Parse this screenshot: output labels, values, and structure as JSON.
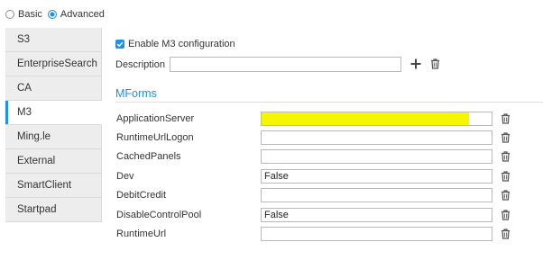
{
  "mode": {
    "basic_label": "Basic",
    "advanced_label": "Advanced",
    "selected": "Advanced"
  },
  "sidebar": {
    "items": [
      {
        "label": "S3"
      },
      {
        "label": "EnterpriseSearch"
      },
      {
        "label": "CA"
      },
      {
        "label": "M3"
      },
      {
        "label": "Ming.le"
      },
      {
        "label": "External"
      },
      {
        "label": "SmartClient"
      },
      {
        "label": "Startpad"
      }
    ],
    "active": "M3"
  },
  "config": {
    "enable_label": "Enable M3 configuration",
    "enabled": true,
    "description_label": "Description",
    "description_value": ""
  },
  "mforms": {
    "title": "MForms",
    "fields": [
      {
        "label": "ApplicationServer",
        "value": ""
      },
      {
        "label": "RuntimeUrlLogon",
        "value": ""
      },
      {
        "label": "CachedPanels",
        "value": ""
      },
      {
        "label": "Dev",
        "value": "False"
      },
      {
        "label": "DebitCredit",
        "value": ""
      },
      {
        "label": "DisableControlPool",
        "value": "False"
      },
      {
        "label": "RuntimeUrl",
        "value": ""
      }
    ]
  },
  "colors": {
    "accent": "#1e90e8",
    "redaction": "#f6f600"
  },
  "icons": {
    "add": "plus-icon",
    "delete": "trash-icon",
    "check": "checkmark-icon"
  }
}
